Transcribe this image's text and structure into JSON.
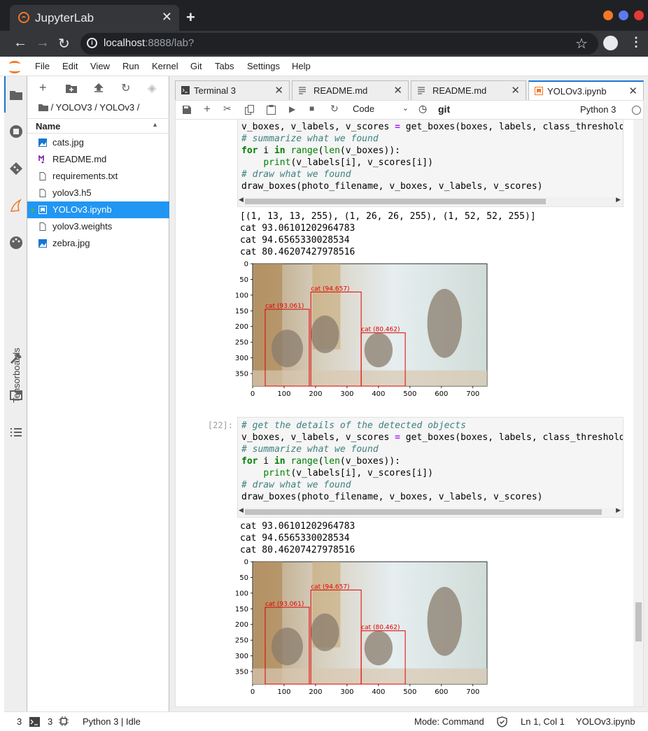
{
  "browser": {
    "tab_title": "JupyterLab",
    "url_host": "localhost",
    "url_path": ":8888/lab?"
  },
  "menu": [
    "File",
    "Edit",
    "View",
    "Run",
    "Kernel",
    "Git",
    "Tabs",
    "Settings",
    "Help"
  ],
  "sidebar": {
    "tensorboards_label": "Tensorboards"
  },
  "filebrowser": {
    "breadcrumb": "/ YOLOV3 / YOLOv3 /",
    "header_name": "Name",
    "files": [
      {
        "name": "cats.jpg",
        "icon": "image-icon"
      },
      {
        "name": "README.md",
        "icon": "markdown-icon"
      },
      {
        "name": "requirements.txt",
        "icon": "file-icon"
      },
      {
        "name": "yolov3.h5",
        "icon": "file-icon"
      },
      {
        "name": "YOLOv3.ipynb",
        "icon": "notebook-icon",
        "selected": true
      },
      {
        "name": "yolov3.weights",
        "icon": "file-icon"
      },
      {
        "name": "zebra.jpg",
        "icon": "image-icon"
      }
    ]
  },
  "tabs": [
    {
      "label": "Terminal 3",
      "icon": "terminal-icon"
    },
    {
      "label": "README.md",
      "icon": "markdown-icon"
    },
    {
      "label": "README.md",
      "icon": "markdown-icon"
    },
    {
      "label": "YOLOv3.ipynb",
      "icon": "notebook-icon",
      "active": true
    }
  ],
  "notebook_toolbar": {
    "cell_type": "Code",
    "git_label": "git",
    "kernel": "Python 3"
  },
  "cell1": {
    "lines": [
      "# get the details of the detected objects",
      "v_boxes, v_labels, v_scores = get_boxes(boxes, labels, class_threshold)",
      "# summarize what we found",
      "for i in range(len(v_boxes)):",
      "    print(v_labels[i], v_scores[i])",
      "# draw what we found",
      "draw_boxes(photo_filename, v_boxes, v_labels, v_scores)"
    ],
    "output": [
      "[(1, 13, 13, 255), (1, 26, 26, 255), (1, 52, 52, 255)]",
      "cat 93.06101202964783",
      "cat 94.6565330028534",
      "cat 80.46207427978516"
    ]
  },
  "cell2": {
    "prompt": "[22]:",
    "output": [
      "cat 93.06101202964783",
      "cat 94.6565330028534",
      "cat 80.46207427978516"
    ]
  },
  "plot": {
    "x_ticks": [
      "0",
      "100",
      "200",
      "300",
      "400",
      "500",
      "600",
      "700"
    ],
    "y_ticks": [
      "0",
      "50",
      "100",
      "150",
      "200",
      "250",
      "300",
      "350"
    ],
    "boxes": [
      {
        "label": "cat (93.061)",
        "x1": 40,
        "y1": 145,
        "x2": 180,
        "y2": 390
      },
      {
        "label": "cat (94.657)",
        "x1": 185,
        "y1": 90,
        "x2": 345,
        "y2": 390
      },
      {
        "label": "cat (80.462)",
        "x1": 345,
        "y1": 220,
        "x2": 485,
        "y2": 390
      }
    ],
    "box_color": "#e00000"
  },
  "status": {
    "count1": "3",
    "count2": "3",
    "kernel_status": "Python 3 | Idle",
    "mode": "Mode: Command",
    "cursor": "Ln 1, Col 1",
    "file": "YOLOv3.ipynb"
  },
  "colors": {
    "accent": "#2196f3",
    "jupyter_orange": "#f37726"
  }
}
